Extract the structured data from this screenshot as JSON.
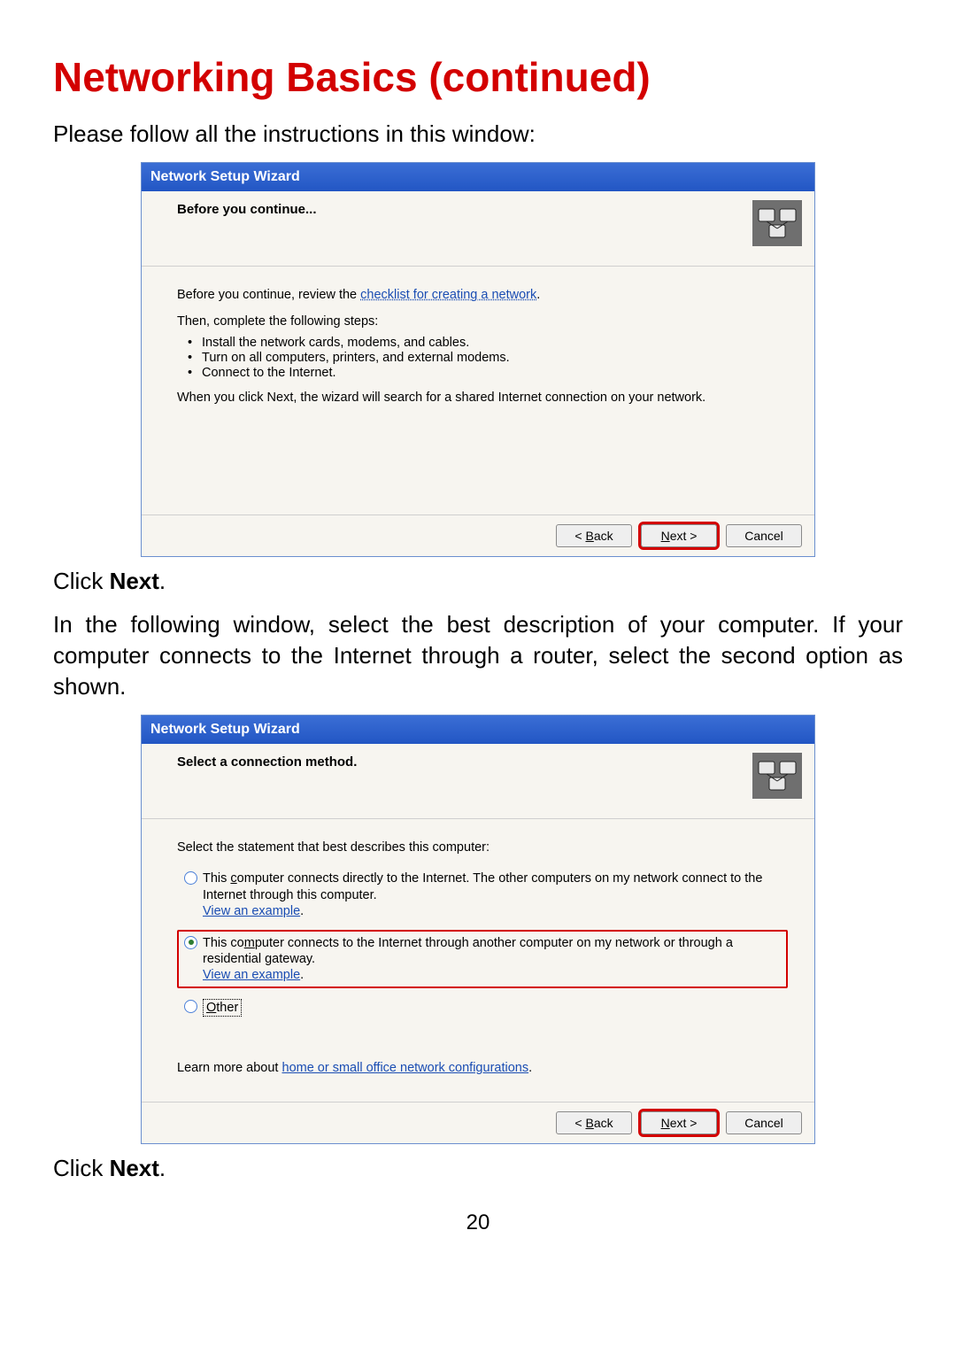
{
  "page": {
    "title": "Networking Basics (continued)",
    "intro": "Please follow all the instructions in this window:",
    "click_next_prefix": "Click ",
    "click_next_bold": "Next",
    "click_next_suffix": ".",
    "para2": "In the following window, select the best description of your computer. If your computer connects to the Internet through a router, select the second option as shown.",
    "number": "20"
  },
  "wizard1": {
    "title": "Network Setup Wizard",
    "header": "Before you continue...",
    "line1_pre": "Before you continue, review the ",
    "line1_link": "checklist for creating a network",
    "line1_post": ".",
    "line2": "Then, complete the following steps:",
    "bullets": [
      "Install the network cards, modems, and cables.",
      "Turn on all computers, printers, and external modems.",
      "Connect to the Internet."
    ],
    "line3": "When you click Next, the wizard will search for a shared Internet connection on your network.",
    "buttons": {
      "back": "< Back",
      "next": "Next >",
      "cancel": "Cancel"
    }
  },
  "wizard2": {
    "title": "Network Setup Wizard",
    "header": "Select a connection method.",
    "prompt": "Select the statement that best describes this computer:",
    "opt1_a": "This ",
    "opt1_u": "c",
    "opt1_b": "omputer connects directly to the Internet. The other computers on my network connect to the Internet through this computer.",
    "opt2_a": "This co",
    "opt2_u": "m",
    "opt2_b": "puter connects to the Internet through another computer on my network or through a residential gateway.",
    "view_example": "View an example",
    "other_u": "O",
    "other_rest": "ther",
    "learn_pre": "Learn more about ",
    "learn_link": "home or small office network configurations",
    "learn_post": ".",
    "buttons": {
      "back": "< Back",
      "next": "Next >",
      "cancel": "Cancel"
    }
  }
}
